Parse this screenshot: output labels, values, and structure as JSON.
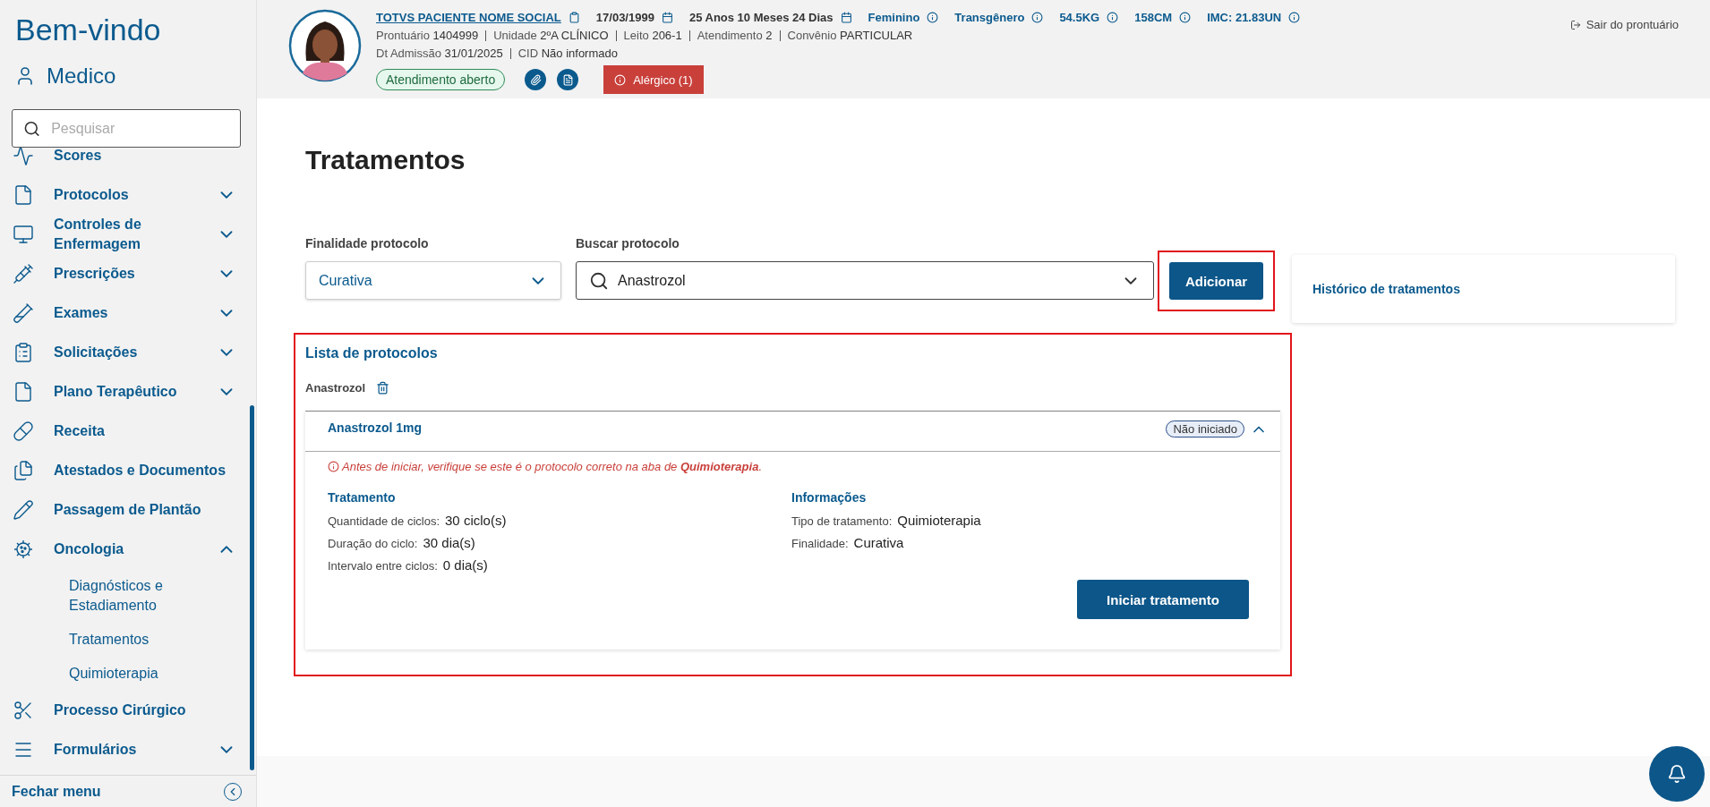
{
  "sidebar": {
    "greeting": "Bem-vindo",
    "user": "Medico",
    "search": {
      "placeholder": "Pesquisar"
    },
    "items": [
      {
        "label": "Scores"
      },
      {
        "label": "Protocolos",
        "expanded": false
      },
      {
        "label": "Controles de Enfermagem",
        "expanded": false
      },
      {
        "label": "Prescrições",
        "expanded": false
      },
      {
        "label": "Exames",
        "expanded": false
      },
      {
        "label": "Solicitações",
        "expanded": false
      },
      {
        "label": "Plano Terapêutico",
        "expanded": false
      },
      {
        "label": "Receita"
      },
      {
        "label": "Atestados e Documentos"
      },
      {
        "label": "Passagem de Plantão"
      },
      {
        "label": "Oncologia",
        "expanded": true,
        "children": [
          {
            "label": "Diagnósticos e Estadiamento"
          },
          {
            "label": "Tratamentos"
          },
          {
            "label": "Quimioterapia"
          }
        ]
      },
      {
        "label": "Processo Cirúrgico"
      },
      {
        "label": "Formulários",
        "expanded": false
      }
    ],
    "footer": "Fechar menu"
  },
  "patient": {
    "name": "TOTVS PACIENTE NOME SOCIAL",
    "birth": "17/03/1999",
    "age": "25 Anos 10 Meses 24 Dias",
    "tags": [
      "Feminino",
      "Transgênero",
      "54.5KG",
      "158CM",
      "IMC: 21.83UN"
    ],
    "line2": [
      {
        "label": "Prontuário",
        "value": "1404999"
      },
      {
        "label": "Unidade",
        "value": "2ºA CLÍNICO"
      },
      {
        "label": "Leito",
        "value": "206-1"
      },
      {
        "label": "Atendimento",
        "value": "2"
      },
      {
        "label": "Convênio",
        "value": "PARTICULAR"
      }
    ],
    "line3": [
      {
        "label": "Dt Admissão",
        "value": "31/01/2025"
      },
      {
        "label": "CID",
        "value": "Não informado"
      }
    ],
    "status": "Atendimento aberto",
    "allergy": "Alérgico (1)",
    "exit": "Sair do prontuário"
  },
  "page": {
    "title": "Tratamentos",
    "filters": [
      {
        "kind": "select",
        "label": "Finalidade protocolo",
        "value": "Curativa"
      },
      {
        "kind": "search",
        "label": "Buscar protocolo",
        "value": "Anastrozol"
      }
    ],
    "add_button": "Adicionar",
    "history": "Histórico de tratamentos",
    "list": {
      "title": "Lista de protocolos",
      "group": "Anastrozol",
      "protocol": {
        "title": "Anastrozol 1mg",
        "status": "Não iniciado",
        "expanded": true,
        "warning": "Antes de iniciar, verifique se este é o protocolo correto na aba de **Quimioterapia**.",
        "sections": [
          {
            "title": "Tratamento",
            "fields": [
              {
                "label": "Quantidade de ciclos:",
                "value": "30 ciclo(s)"
              },
              {
                "label": "Duração do ciclo:",
                "value": "30 dia(s)"
              },
              {
                "label": "Intervalo entre ciclos:",
                "value": "0 dia(s)"
              }
            ]
          },
          {
            "title": "Informações",
            "fields": [
              {
                "label": "Tipo de tratamento:",
                "value": "Quimioterapia"
              },
              {
                "label": "Finalidade:",
                "value": "Curativa"
              }
            ]
          }
        ],
        "button": "Iniciar tratamento"
      }
    }
  }
}
